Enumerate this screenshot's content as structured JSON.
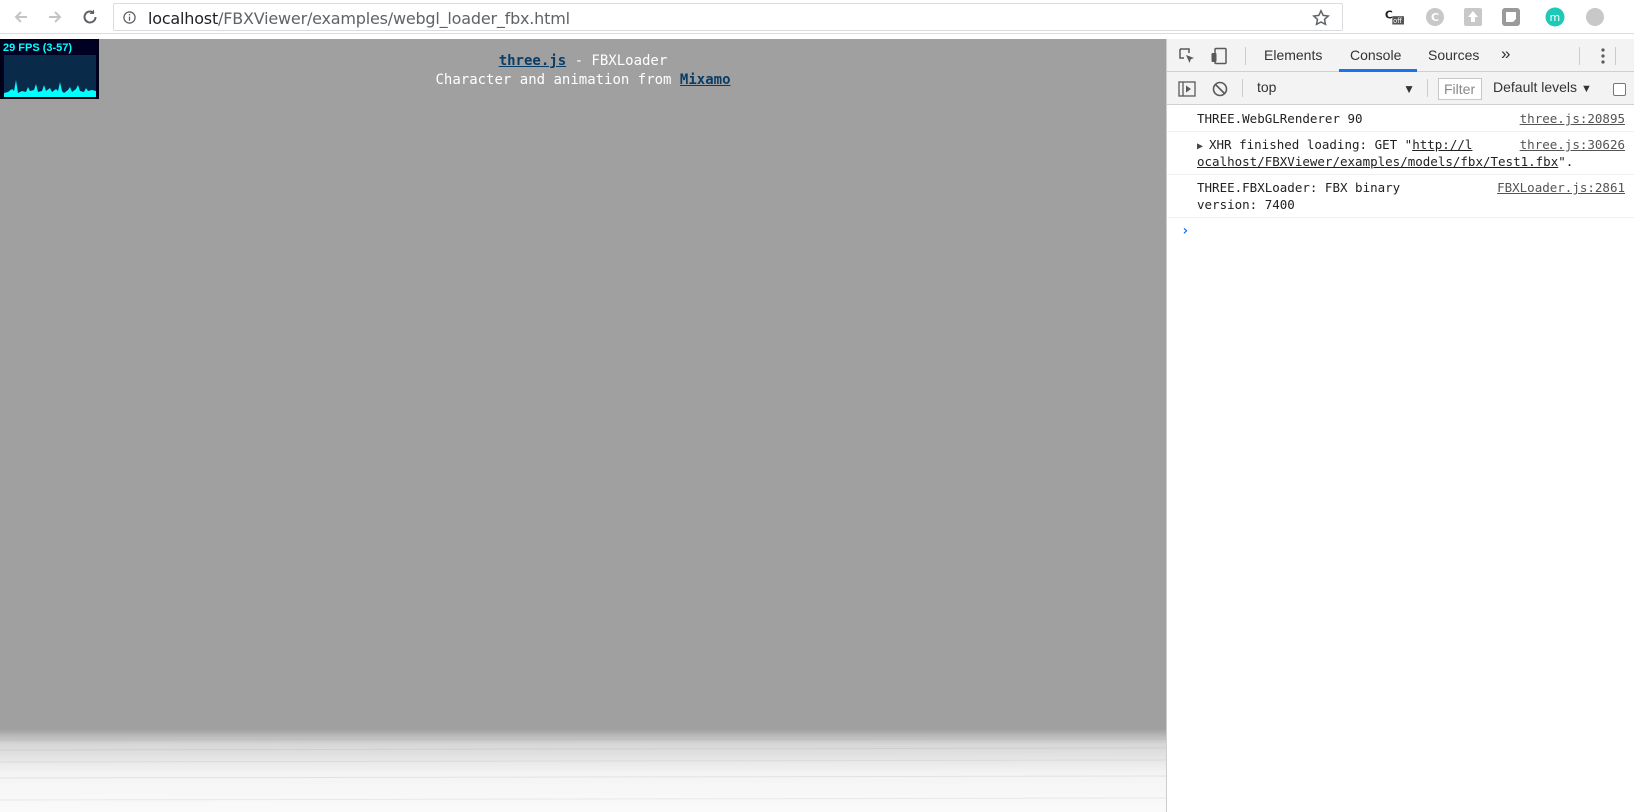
{
  "browser": {
    "url_host": "localhost",
    "url_path": "/FBXViewer/examples/webgl_loader_fbx.html",
    "extensions": [
      "coins-off-icon",
      "c-extension-icon",
      "upload-extension-icon",
      "note-extension-icon",
      "m-extension-icon",
      "grey-extension-icon"
    ],
    "extension_badge": "off"
  },
  "page": {
    "stats_label": "29 FPS (3-57)",
    "info_link_threejs": "three.js",
    "info_title_rest": " - FBXLoader",
    "info_line2_prefix": "Character and animation from ",
    "info_link_mixamo": "Mixamo"
  },
  "devtools": {
    "tabs": [
      "Elements",
      "Console",
      "Sources"
    ],
    "active_tab": "Console",
    "more_tabs": "»",
    "context": "top",
    "filter_placeholder": "Filter",
    "levels": "Default levels",
    "messages": [
      {
        "text": "THREE.WebGLRenderer 90",
        "source": "three.js:20895"
      },
      {
        "prefix": "XHR finished loading: GET \"",
        "link_part1": "http://l",
        "link_part2": "ocalhost/FBXViewer/examples/models/fbx/Test1.fbx",
        "suffix": "\".",
        "source": "three.js:30626"
      },
      {
        "line1": "THREE.FBXLoader: FBX binary",
        "line2": "version: 7400",
        "source": "FBXLoader.js:2861"
      }
    ],
    "prompt_symbol": "›"
  },
  "colors": {
    "page_background": "#a0a0a0",
    "stats_text": "#00ffff",
    "active_tab_underline": "#1a73e8"
  }
}
